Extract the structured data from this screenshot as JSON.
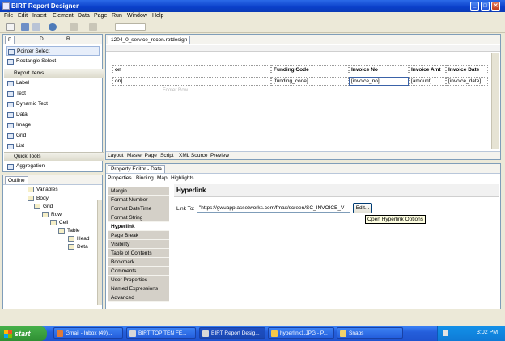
{
  "window": {
    "title": "BIRT Report Designer"
  },
  "menu": [
    "File",
    "Edit",
    "Insert",
    "Element",
    "Data",
    "Page",
    "Run",
    "Window",
    "Help"
  ],
  "palette": {
    "tabs": [
      "P",
      "D",
      "R"
    ],
    "items": [
      "Pointer Select",
      "Rectangle Select"
    ],
    "report_items_header": "Report Items",
    "report_items": [
      "Label",
      "Text",
      "Dynamic Text",
      "Data",
      "Image",
      "Grid",
      "List"
    ],
    "quick_tools_header": "Quick Tools",
    "quick_tools": [
      "Aggregation"
    ]
  },
  "outline": {
    "tab": "Outline",
    "items": [
      "Variables",
      "Body",
      "Grid",
      "Row",
      "Cell",
      "Table",
      "Head",
      "Deta"
    ]
  },
  "editor": {
    "tab": "1204_0_service_recon.rptdesign",
    "headers": [
      "on",
      "Funding Code",
      "Invoice No",
      "Invoice Amt",
      "Invoice Date"
    ],
    "row": [
      "on]",
      "[funding_code]",
      "[invoice_no]",
      "[amount]",
      "[invoice_date]"
    ],
    "footer_row": "Footer Row",
    "bottom_tabs": [
      "Layout",
      "Master Page",
      "Script",
      "XML Source",
      "Preview"
    ]
  },
  "property_editor": {
    "title": "Property Editor - Data",
    "tabs": [
      "Properties",
      "Binding",
      "Map",
      "Highlights"
    ],
    "categories": [
      "Margin",
      "Format Number",
      "Format DateTime",
      "Format String",
      "Hyperlink",
      "Page Break",
      "Visibility",
      "Table of Contents",
      "Bookmark",
      "Comments",
      "User Properties",
      "Named Expressions",
      "Advanced"
    ],
    "section_title": "Hyperlink",
    "link_label": "Link To:",
    "link_value": "\"https://gwuapp.assetworks.com/fmax/screen/SC_INVOICE_V",
    "edit_button": "Edit...",
    "tooltip": "Open Hyperlink Options"
  },
  "taskbar": {
    "start": "start",
    "tasks": [
      "Gmail - Inbox (49)...",
      "BIRT TOP TEN FE...",
      "BIRT Report Desig...",
      "hyperlink1.JPG - P...",
      "Snaps"
    ],
    "clock": "3:02 PM"
  }
}
